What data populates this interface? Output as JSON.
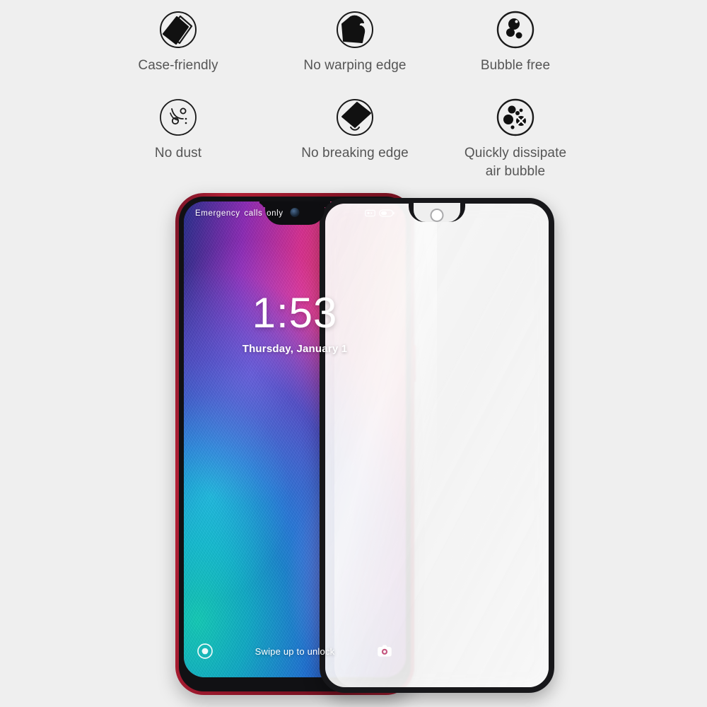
{
  "background_color": "#efefef",
  "features": [
    {
      "label": "Case-friendly",
      "icon": "case-friendly-icon"
    },
    {
      "label": "No warping edge",
      "icon": "no-warping-edge-icon"
    },
    {
      "label": "Bubble free",
      "icon": "bubble-free-icon"
    },
    {
      "label": "No dust",
      "icon": "no-dust-icon"
    },
    {
      "label": "No breaking edge",
      "icon": "no-breaking-edge-icon"
    },
    {
      "label": "Quickly dissipate\nair bubble",
      "icon": "quickly-dissipate-air-bubble-icon"
    }
  ],
  "feature_text_color": "#555555",
  "phone": {
    "body_color": "#a81d31",
    "bezel_color": "#111114",
    "status_bar": {
      "carrier_text": "Emergency calls only",
      "signal_icon": "signal-icon",
      "battery_icon": "battery-icon"
    },
    "lock_screen": {
      "time": "1:53",
      "date": "Thursday, January 1",
      "swipe_hint": "Swipe up to unlock",
      "left_icon": "flashlight-icon",
      "right_icon": "camera-icon"
    },
    "notch": "waterdrop-notch",
    "front_camera": "front-camera-icon"
  },
  "protector": {
    "frame_color": "#17171a",
    "notch": "waterdrop-notch-cutout"
  }
}
